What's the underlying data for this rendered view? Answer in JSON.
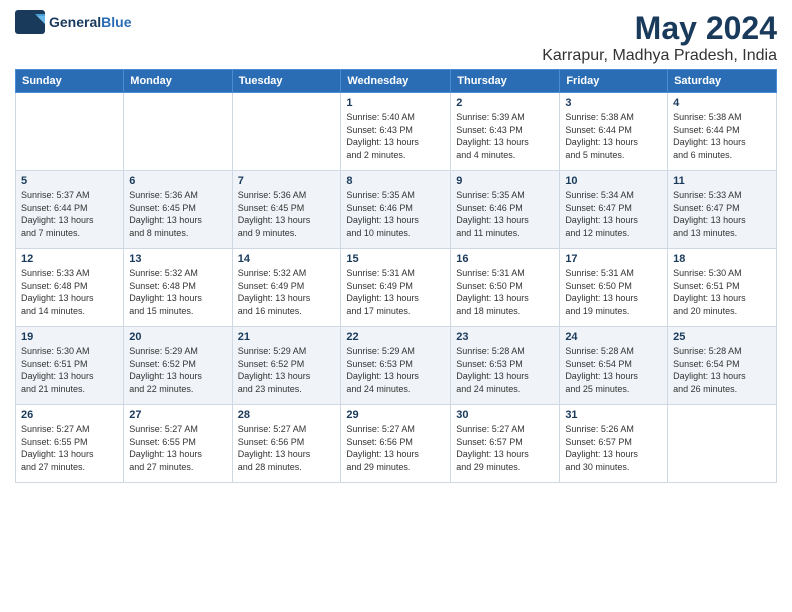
{
  "logo": {
    "line1": "General",
    "line2": "Blue"
  },
  "title": "May 2024",
  "subtitle": "Karrapur, Madhya Pradesh, India",
  "days_of_week": [
    "Sunday",
    "Monday",
    "Tuesday",
    "Wednesday",
    "Thursday",
    "Friday",
    "Saturday"
  ],
  "weeks": [
    [
      {
        "day": "",
        "text": ""
      },
      {
        "day": "",
        "text": ""
      },
      {
        "day": "",
        "text": ""
      },
      {
        "day": "1",
        "text": "Sunrise: 5:40 AM\nSunset: 6:43 PM\nDaylight: 13 hours\nand 2 minutes."
      },
      {
        "day": "2",
        "text": "Sunrise: 5:39 AM\nSunset: 6:43 PM\nDaylight: 13 hours\nand 4 minutes."
      },
      {
        "day": "3",
        "text": "Sunrise: 5:38 AM\nSunset: 6:44 PM\nDaylight: 13 hours\nand 5 minutes."
      },
      {
        "day": "4",
        "text": "Sunrise: 5:38 AM\nSunset: 6:44 PM\nDaylight: 13 hours\nand 6 minutes."
      }
    ],
    [
      {
        "day": "5",
        "text": "Sunrise: 5:37 AM\nSunset: 6:44 PM\nDaylight: 13 hours\nand 7 minutes."
      },
      {
        "day": "6",
        "text": "Sunrise: 5:36 AM\nSunset: 6:45 PM\nDaylight: 13 hours\nand 8 minutes."
      },
      {
        "day": "7",
        "text": "Sunrise: 5:36 AM\nSunset: 6:45 PM\nDaylight: 13 hours\nand 9 minutes."
      },
      {
        "day": "8",
        "text": "Sunrise: 5:35 AM\nSunset: 6:46 PM\nDaylight: 13 hours\nand 10 minutes."
      },
      {
        "day": "9",
        "text": "Sunrise: 5:35 AM\nSunset: 6:46 PM\nDaylight: 13 hours\nand 11 minutes."
      },
      {
        "day": "10",
        "text": "Sunrise: 5:34 AM\nSunset: 6:47 PM\nDaylight: 13 hours\nand 12 minutes."
      },
      {
        "day": "11",
        "text": "Sunrise: 5:33 AM\nSunset: 6:47 PM\nDaylight: 13 hours\nand 13 minutes."
      }
    ],
    [
      {
        "day": "12",
        "text": "Sunrise: 5:33 AM\nSunset: 6:48 PM\nDaylight: 13 hours\nand 14 minutes."
      },
      {
        "day": "13",
        "text": "Sunrise: 5:32 AM\nSunset: 6:48 PM\nDaylight: 13 hours\nand 15 minutes."
      },
      {
        "day": "14",
        "text": "Sunrise: 5:32 AM\nSunset: 6:49 PM\nDaylight: 13 hours\nand 16 minutes."
      },
      {
        "day": "15",
        "text": "Sunrise: 5:31 AM\nSunset: 6:49 PM\nDaylight: 13 hours\nand 17 minutes."
      },
      {
        "day": "16",
        "text": "Sunrise: 5:31 AM\nSunset: 6:50 PM\nDaylight: 13 hours\nand 18 minutes."
      },
      {
        "day": "17",
        "text": "Sunrise: 5:31 AM\nSunset: 6:50 PM\nDaylight: 13 hours\nand 19 minutes."
      },
      {
        "day": "18",
        "text": "Sunrise: 5:30 AM\nSunset: 6:51 PM\nDaylight: 13 hours\nand 20 minutes."
      }
    ],
    [
      {
        "day": "19",
        "text": "Sunrise: 5:30 AM\nSunset: 6:51 PM\nDaylight: 13 hours\nand 21 minutes."
      },
      {
        "day": "20",
        "text": "Sunrise: 5:29 AM\nSunset: 6:52 PM\nDaylight: 13 hours\nand 22 minutes."
      },
      {
        "day": "21",
        "text": "Sunrise: 5:29 AM\nSunset: 6:52 PM\nDaylight: 13 hours\nand 23 minutes."
      },
      {
        "day": "22",
        "text": "Sunrise: 5:29 AM\nSunset: 6:53 PM\nDaylight: 13 hours\nand 24 minutes."
      },
      {
        "day": "23",
        "text": "Sunrise: 5:28 AM\nSunset: 6:53 PM\nDaylight: 13 hours\nand 24 minutes."
      },
      {
        "day": "24",
        "text": "Sunrise: 5:28 AM\nSunset: 6:54 PM\nDaylight: 13 hours\nand 25 minutes."
      },
      {
        "day": "25",
        "text": "Sunrise: 5:28 AM\nSunset: 6:54 PM\nDaylight: 13 hours\nand 26 minutes."
      }
    ],
    [
      {
        "day": "26",
        "text": "Sunrise: 5:27 AM\nSunset: 6:55 PM\nDaylight: 13 hours\nand 27 minutes."
      },
      {
        "day": "27",
        "text": "Sunrise: 5:27 AM\nSunset: 6:55 PM\nDaylight: 13 hours\nand 27 minutes."
      },
      {
        "day": "28",
        "text": "Sunrise: 5:27 AM\nSunset: 6:56 PM\nDaylight: 13 hours\nand 28 minutes."
      },
      {
        "day": "29",
        "text": "Sunrise: 5:27 AM\nSunset: 6:56 PM\nDaylight: 13 hours\nand 29 minutes."
      },
      {
        "day": "30",
        "text": "Sunrise: 5:27 AM\nSunset: 6:57 PM\nDaylight: 13 hours\nand 29 minutes."
      },
      {
        "day": "31",
        "text": "Sunrise: 5:26 AM\nSunset: 6:57 PM\nDaylight: 13 hours\nand 30 minutes."
      },
      {
        "day": "",
        "text": ""
      }
    ]
  ]
}
